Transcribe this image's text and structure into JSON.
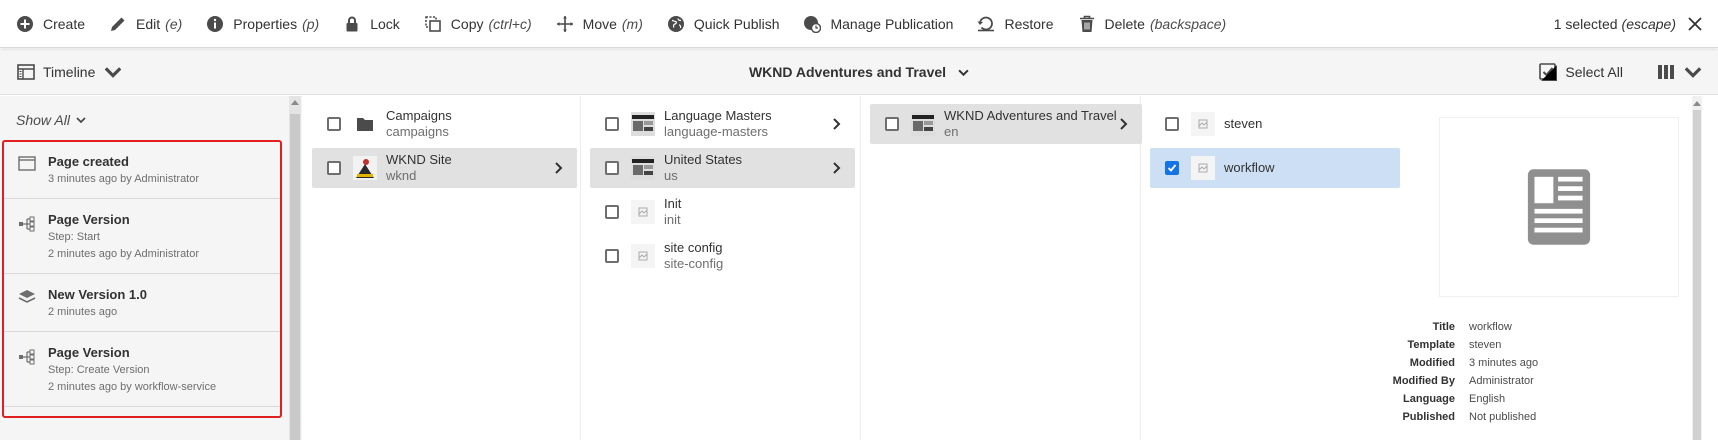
{
  "actionbar": {
    "actions": [
      {
        "label": "Create",
        "shortcut": "",
        "icon": "add-circle-icon"
      },
      {
        "label": "Edit",
        "shortcut": "(e)",
        "icon": "pencil-icon"
      },
      {
        "label": "Properties",
        "shortcut": "(p)",
        "icon": "info-icon"
      },
      {
        "label": "Lock",
        "shortcut": "",
        "icon": "lock-icon"
      },
      {
        "label": "Copy",
        "shortcut": "(ctrl+c)",
        "icon": "copy-icon"
      },
      {
        "label": "Move",
        "shortcut": "(m)",
        "icon": "move-icon"
      },
      {
        "label": "Quick Publish",
        "shortcut": "",
        "icon": "globe-icon"
      },
      {
        "label": "Manage Publication",
        "shortcut": "",
        "icon": "globe-clock-icon"
      },
      {
        "label": "Restore",
        "shortcut": "",
        "icon": "restore-icon"
      },
      {
        "label": "Delete",
        "shortcut": "(backspace)",
        "icon": "trash-icon"
      }
    ],
    "selection": {
      "label": "1 selected",
      "shortcut": "(escape)",
      "close_icon": "close-icon"
    }
  },
  "subbar": {
    "rail_label": "Timeline",
    "breadcrumb": "WKND Adventures and Travel",
    "select_all": "Select All",
    "view_icon": "column-view-icon"
  },
  "timeline": {
    "filter": "Show All",
    "items": [
      {
        "title": "Page created",
        "step": "",
        "meta": "3 minutes ago by Administrator",
        "icon": "page-icon"
      },
      {
        "title": "Page Version",
        "step": "Step: Start",
        "meta": "2 minutes ago by Administrator",
        "icon": "workflow-icon"
      },
      {
        "title": "New Version 1.0",
        "step": "",
        "meta": "2 minutes ago",
        "icon": "layers-icon"
      },
      {
        "title": "Page Version",
        "step": "Step: Create Version",
        "meta": "2 minutes ago by workflow-service",
        "icon": "workflow-icon"
      }
    ]
  },
  "columns": [
    {
      "items": [
        {
          "title": "Campaigns",
          "name": "campaigns",
          "thumb": "folder-icon",
          "has_children": false,
          "state": "none"
        },
        {
          "title": "WKND Site",
          "name": "wknd",
          "thumb": "site-image",
          "has_children": true,
          "state": "selected"
        }
      ]
    },
    {
      "items": [
        {
          "title": "Language Masters",
          "name": "language-masters",
          "thumb": "page-image",
          "has_children": true,
          "state": "none"
        },
        {
          "title": "United States",
          "name": "us",
          "thumb": "page-image",
          "has_children": true,
          "state": "selected"
        },
        {
          "title": "Init",
          "name": "init",
          "thumb": "page-placeholder-icon",
          "has_children": false,
          "state": "none"
        },
        {
          "title": "site config",
          "name": "site-config",
          "thumb": "page-placeholder-icon",
          "has_children": false,
          "state": "none"
        }
      ]
    },
    {
      "items": [
        {
          "title": "WKND Adventures and Travel",
          "name": "en",
          "thumb": "page-image",
          "has_children": true,
          "state": "selected"
        }
      ]
    },
    {
      "items": [
        {
          "title": "steven",
          "name": "",
          "thumb": "page-placeholder-icon",
          "has_children": false,
          "state": "none"
        },
        {
          "title": "workflow",
          "name": "",
          "thumb": "page-placeholder-icon",
          "has_children": false,
          "state": "checked"
        }
      ]
    }
  ],
  "preview": {
    "icon": "document-icon",
    "meta": [
      {
        "key": "Title",
        "value": "workflow"
      },
      {
        "key": "Template",
        "value": "steven"
      },
      {
        "key": "Modified",
        "value": "3 minutes ago"
      },
      {
        "key": "Modified By",
        "value": "Administrator"
      },
      {
        "key": "Language",
        "value": "English"
      },
      {
        "key": "Published",
        "value": "Not published"
      }
    ]
  },
  "colors": {
    "accent": "#1473e6",
    "highlight": "#e02020",
    "selected_row": "#e1e1e1",
    "checked_row": "#cddff5"
  }
}
